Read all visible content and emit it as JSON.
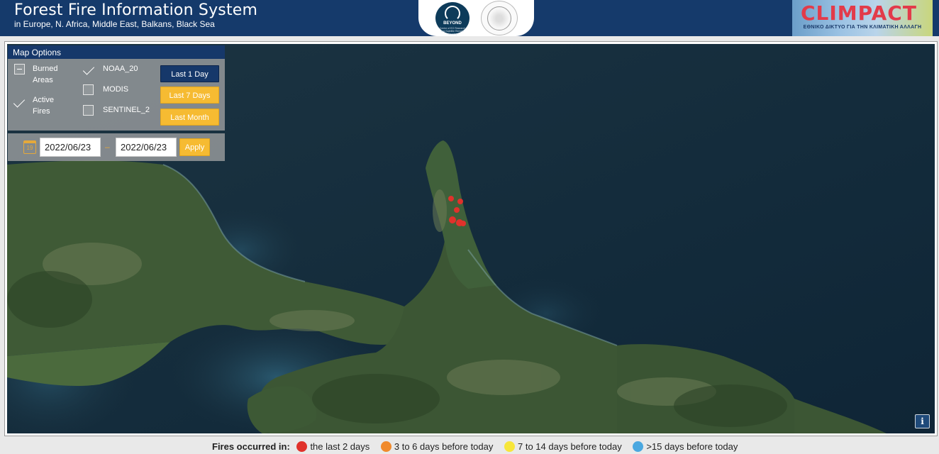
{
  "header": {
    "title": "Forest Fire Information System",
    "subtitle": "in Europe, N. Africa, Middle East, Balkans, Black Sea",
    "partner_logo_1": {
      "icon": "beyond-logo-icon",
      "text": "BEYOND",
      "small_text": "Centre of EO Research and Satellite Remote Sensing"
    },
    "partner_logo_2": {
      "icon": "observatory-seal-icon"
    },
    "brand": {
      "name": "CLIMPACT",
      "tagline": "ΕΘΝΙΚΟ ΔΙΚΤΥΟ ΓΙΑ ΤΗΝ ΚΛΙΜΑΤΙΚΗ ΑΛΛΑΓΗ",
      "color": "#e23b4a"
    }
  },
  "map_options": {
    "title": "Map Options",
    "layers": [
      {
        "label_line1": "Burned",
        "label_line2": "Areas",
        "state": "partial"
      },
      {
        "label_line1": "Active",
        "label_line2": "Fires",
        "state": "checked"
      }
    ],
    "sensors": [
      {
        "label": "NOAA_20",
        "checked": true
      },
      {
        "label": "MODIS",
        "checked": false
      },
      {
        "label": "SENTINEL_2",
        "checked": false
      }
    ],
    "periods": [
      {
        "label": "Last 1 Day",
        "active": true
      },
      {
        "label": "Last 7 Days",
        "active": false
      },
      {
        "label": "Last Month",
        "active": false
      }
    ],
    "date_icon_text": "19",
    "date_from": "2022/06/23",
    "date_separator": "–",
    "date_to": "2022/06/23",
    "apply_label": "Apply"
  },
  "map": {
    "info_label": "i",
    "fire_color": "#e0322b"
  },
  "legend": {
    "title": "Fires occurred in:",
    "items": [
      {
        "label": "the last 2 days",
        "color": "#e0322b"
      },
      {
        "label": "3 to 6 days before today",
        "color": "#f08a2c"
      },
      {
        "label": "7 to 14 days before today",
        "color": "#f7e63a"
      },
      {
        "label": ">15 days before today",
        "color": "#4aa8e0"
      }
    ]
  }
}
